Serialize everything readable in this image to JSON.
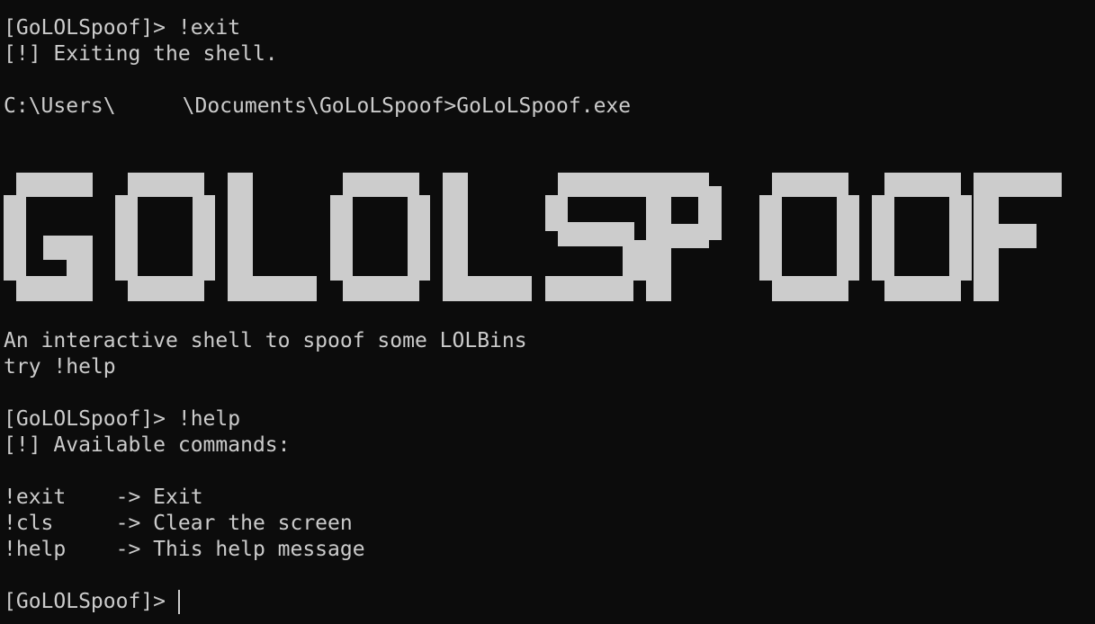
{
  "terminal": {
    "lines": {
      "prompt_exit": "[GoLOLSpoof]> !exit",
      "exiting": "[!] Exiting the shell.",
      "cmd_prefix": "C:\\Users\\",
      "cmd_suffix": "\\Documents\\GoLoLSpoof>GoLoLSpoof.exe",
      "description": "An interactive shell to spoof some LOLBins",
      "try_help": "try !help",
      "prompt_help": "[GoLOLSpoof]> !help",
      "available": "[!] Available commands:",
      "cmd_exit": "!exit    -> Exit",
      "cmd_cls": "!cls     -> Clear the screen",
      "cmd_help": "!help    -> This help message",
      "prompt_current": "[GoLOLSpoof]>"
    },
    "banner_text": "GOLOLSPOOF",
    "colors": {
      "background": "#0c0c0c",
      "foreground": "#cccccc"
    }
  }
}
